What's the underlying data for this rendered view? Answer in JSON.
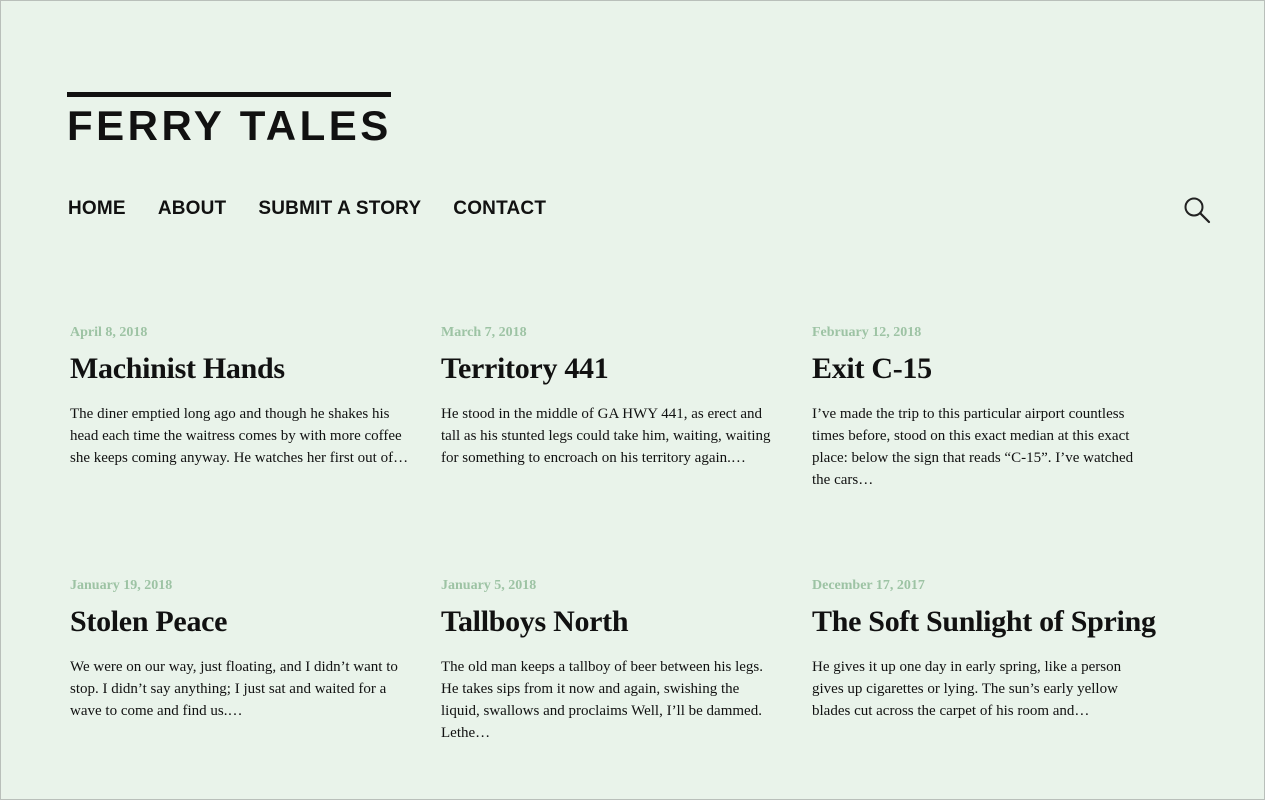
{
  "site": {
    "title": "FERRY TALES"
  },
  "nav": {
    "items": [
      {
        "label": "HOME"
      },
      {
        "label": "ABOUT"
      },
      {
        "label": "SUBMIT A STORY"
      },
      {
        "label": "CONTACT"
      }
    ],
    "search_icon": "search-icon"
  },
  "colors": {
    "background": "#e9f3ea",
    "date": "#9dc3a4",
    "text": "#111111"
  },
  "posts": [
    {
      "date": "April 8, 2018",
      "title": "Machinist Hands",
      "excerpt": "The diner emptied long ago and though he shakes his head each time the waitress comes by with more coffee she keeps coming anyway. He watches her first out of…"
    },
    {
      "date": "March 7, 2018",
      "title": "Territory 441",
      "excerpt": "He stood in the middle of GA HWY 441, as erect and tall as his stunted legs could take him, waiting, waiting for something to encroach on his territory again.…"
    },
    {
      "date": "February 12, 2018",
      "title": "Exit C-15",
      "excerpt": "I’ve made the trip to this particular airport countless times before, stood on this exact median at this exact place: below the sign that reads “C-15”. I’ve watched the cars…"
    },
    {
      "date": "January 19, 2018",
      "title": "Stolen Peace",
      "excerpt": "We were on our way, just floating, and I didn’t want to stop. I didn’t say anything; I just sat and waited for a wave to come and find us.…"
    },
    {
      "date": "January 5, 2018",
      "title": "Tallboys North",
      "excerpt": "The old man keeps a tallboy of beer between his legs. He takes sips from it now and again, swishing the liquid, swallows and proclaims Well, I’ll be dammed. Lethe…"
    },
    {
      "date": "December 17, 2017",
      "title": "The Soft Sunlight of Spring",
      "excerpt": "He gives it up one day in early spring, like a person gives up cigarettes or lying. The sun’s early yellow blades cut across the carpet of his room and…"
    }
  ]
}
